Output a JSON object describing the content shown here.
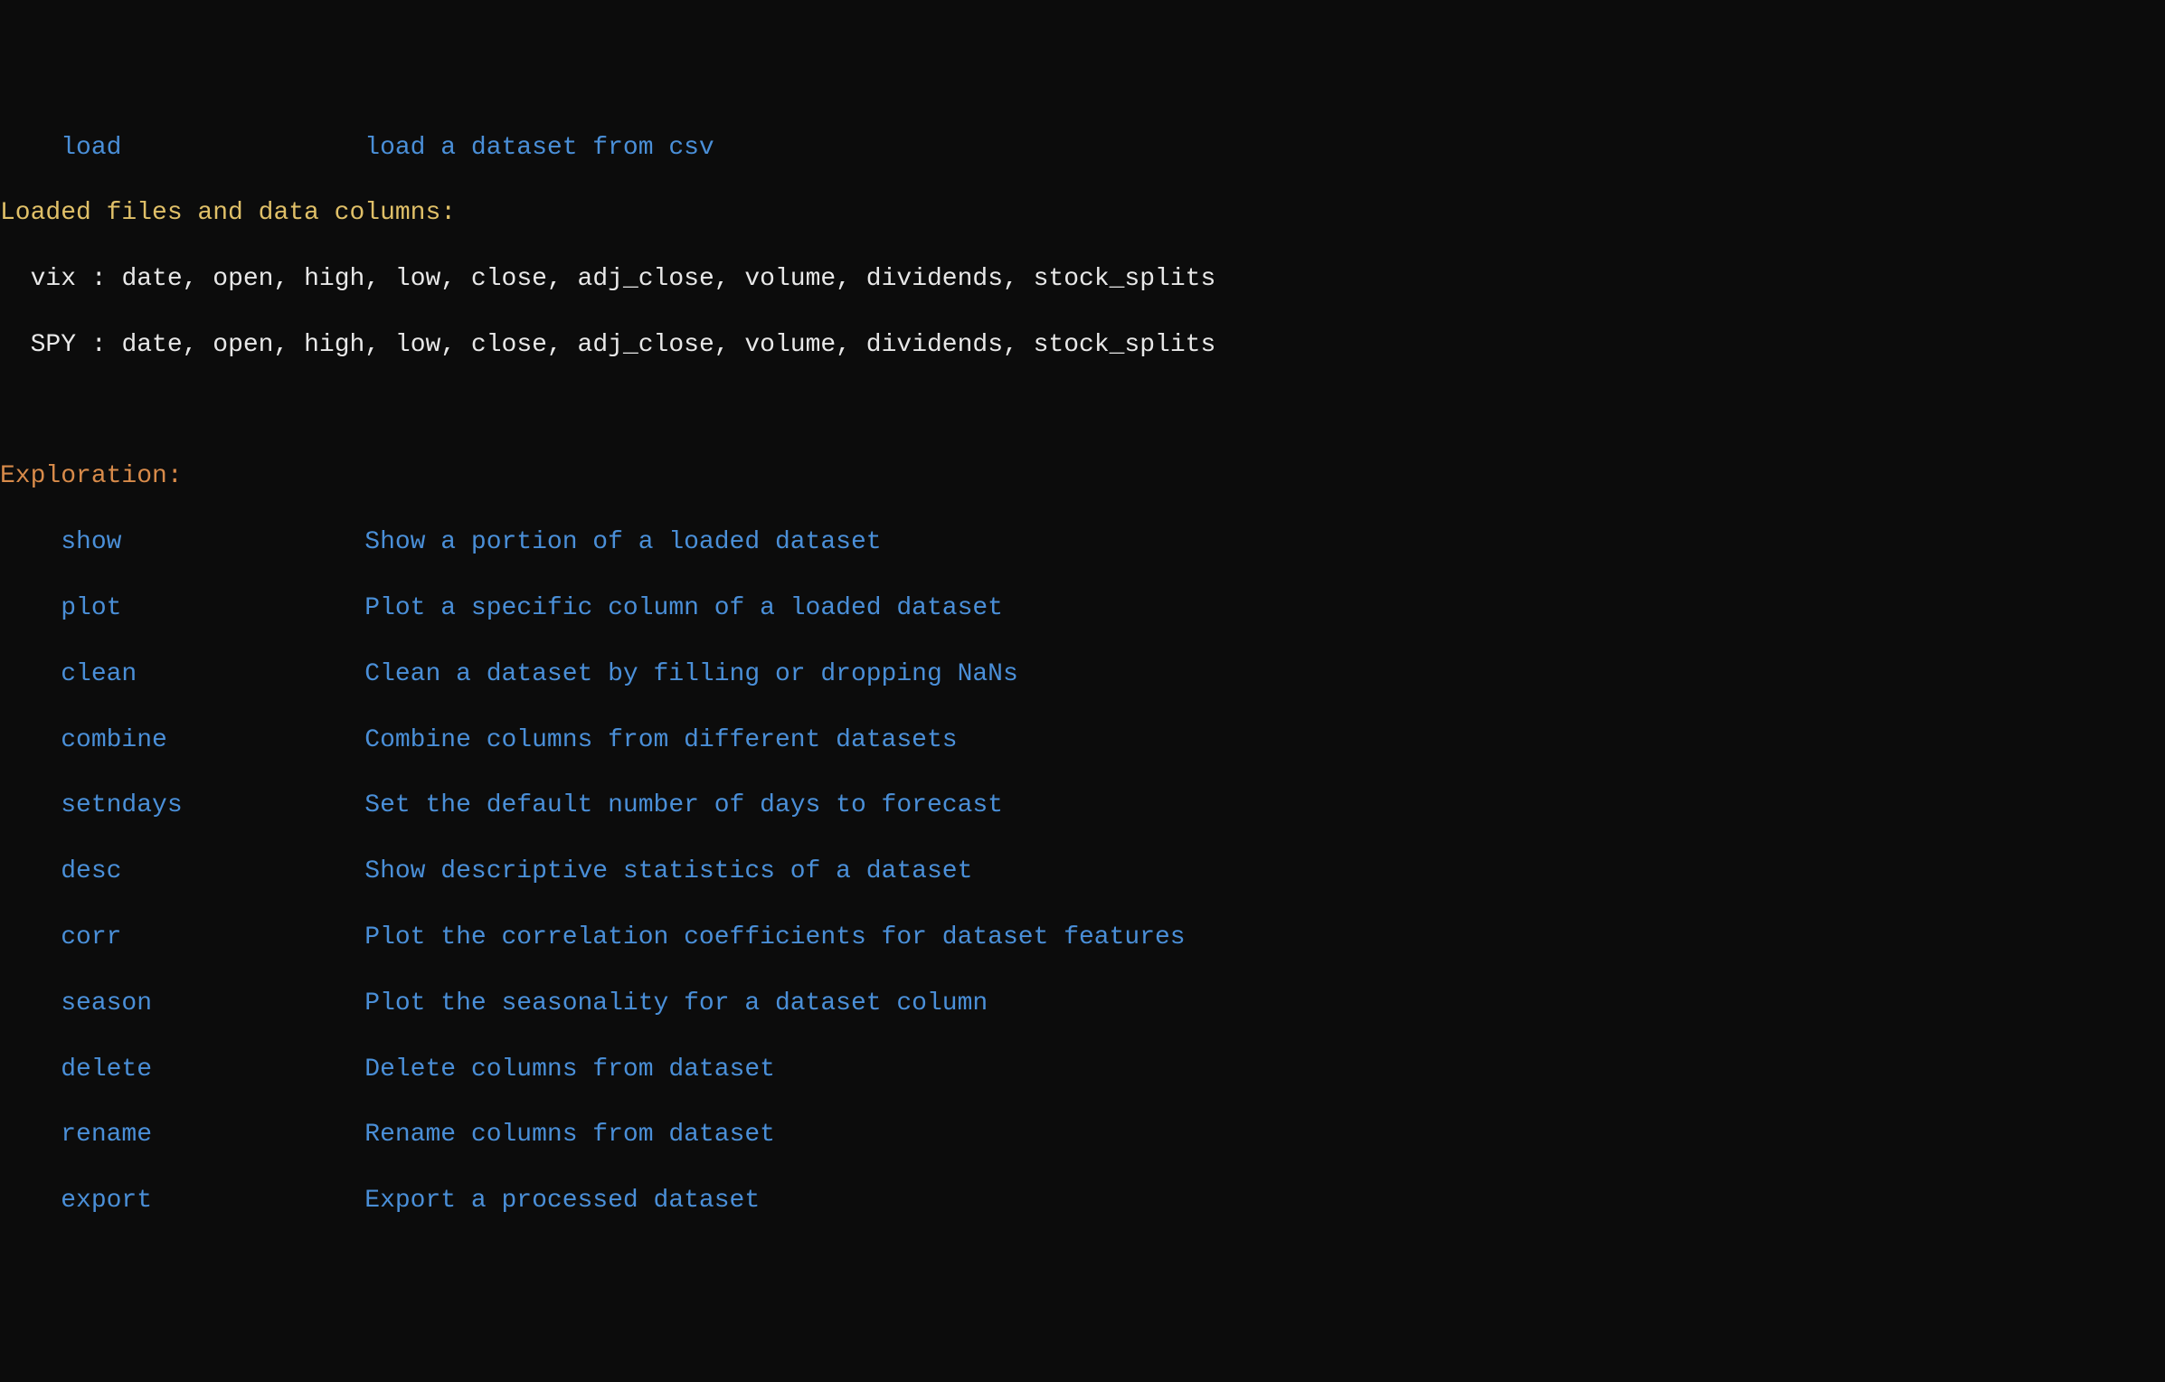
{
  "load_section": {
    "indent": "    ",
    "command": "load",
    "description": "load a dataset from csv"
  },
  "loaded_files": {
    "header": "Loaded files and data columns:",
    "entries": [
      {
        "name": "vix",
        "columns": "date, open, high, low, close, adj_close, volume, dividends, stock_splits"
      },
      {
        "name": "SPY",
        "columns": "date, open, high, low, close, adj_close, volume, dividends, stock_splits"
      }
    ]
  },
  "exploration": {
    "header": "Exploration:",
    "commands": [
      {
        "name": "show",
        "description": "Show a portion of a loaded dataset"
      },
      {
        "name": "plot",
        "description": "Plot a specific column of a loaded dataset"
      },
      {
        "name": "clean",
        "description": "Clean a dataset by filling or dropping NaNs"
      },
      {
        "name": "combine",
        "description": "Combine columns from different datasets"
      },
      {
        "name": "setndays",
        "description": "Set the default number of days to forecast"
      },
      {
        "name": "desc",
        "description": "Show descriptive statistics of a dataset"
      },
      {
        "name": "corr",
        "description": "Plot the correlation coefficients for dataset features"
      },
      {
        "name": "season",
        "description": "Plot the seasonality for a dataset column"
      },
      {
        "name": "delete",
        "description": "Delete columns from dataset"
      },
      {
        "name": "rename",
        "description": "Rename columns from dataset"
      },
      {
        "name": "export",
        "description": "Export a processed dataset"
      }
    ]
  }
}
